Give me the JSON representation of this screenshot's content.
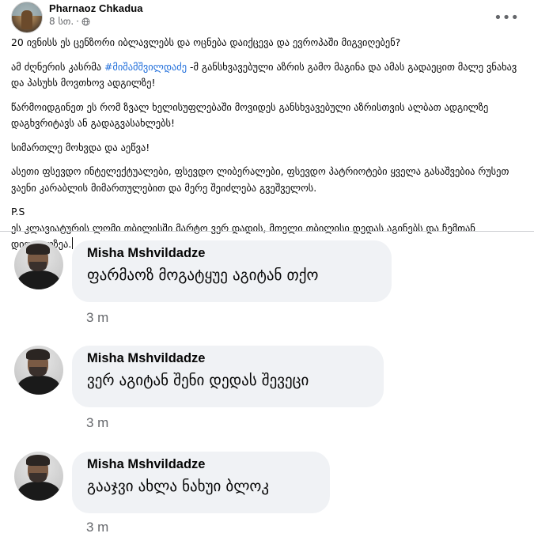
{
  "post": {
    "author": "Pharnaoz Chkadua",
    "time": "8 სთ.",
    "privacy_icon": "globe-icon",
    "more_icon": "more-options-icon",
    "paragraphs": [
      "20 ივნისს ეს ცენზორი იბლავლებს და ოცნება დაიქცევა და ევროპაში მიგვიღებენ?",
      {
        "before": "ამ ძღნერის კასრმა ",
        "hashtag": "#მიშამშვილდაძე",
        "after": " -მ განსხვავებული აზრის გამო მაგინა და ამას გადაეცით მალე ვნახავ და პასუხს მოვთხოვ ადგილზე!"
      },
      "წარმოიდგინეთ ეს რომ ზვალ ხელისუფლებაში მოვიდეს განსხვავებული აზრისთვის ალბათ ადგილზე დაგხვრიტავს ან გადაგვასახლებს!",
      "სიმართლე მოხვდა და აეწვა!",
      "ასეთი ფსევდო ინტელექტუალები, ფსევდო ლიბერალები, ფსევდო პატრიოტები ყველა გასაშვებია რუსეთ ვაენი კარაბლის მიმართულებით და მერე შეიძლება გვეშველოს.",
      "P.S",
      "ეს კლავიატურის ლომი თბილისში მარტო ვერ დადის, მთელი თბილისი დედას აგინებს და ჩემთან დიდგულზეა."
    ]
  },
  "comments": [
    {
      "name": "Misha Mshvildadze",
      "text": "ფარმაოზ მოგატყუე აგიტან თქო",
      "time": "3 m"
    },
    {
      "name": "Misha Mshvildadze",
      "text": "ვერ აგიტან შენი დედას შევეცი",
      "time": "3 m"
    },
    {
      "name": "Misha Mshvildadze",
      "text": "გააჯვი ახლა ნახუი ბლოკ",
      "time": "3 m"
    }
  ]
}
